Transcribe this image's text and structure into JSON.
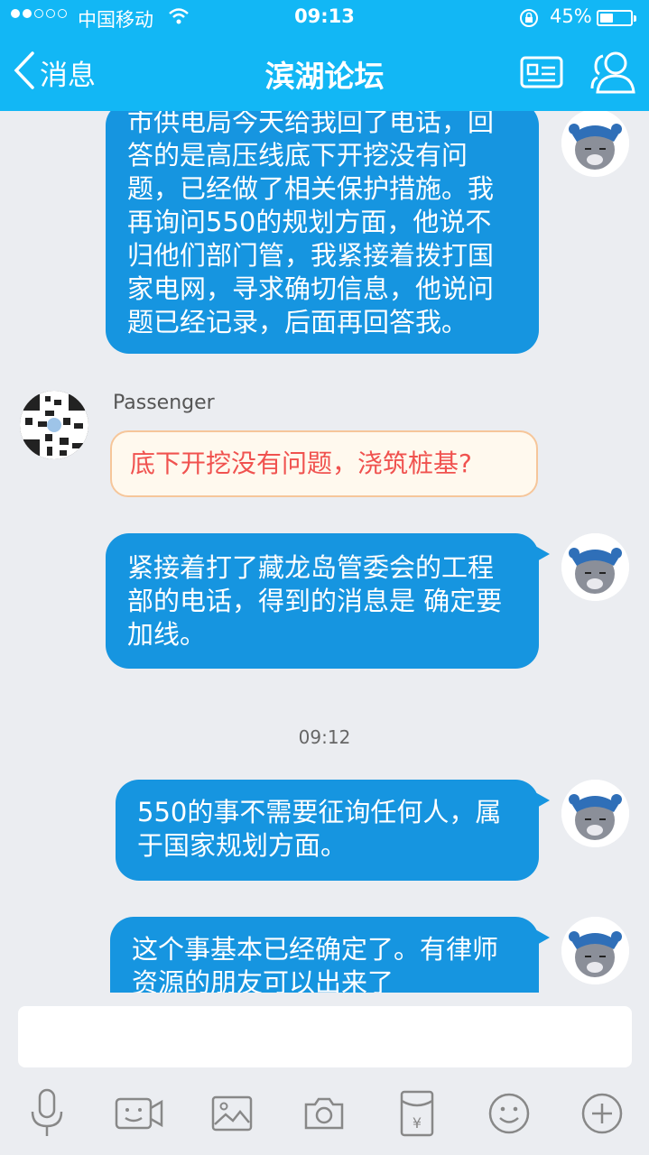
{
  "status": {
    "carrier": "中国移动",
    "time": "09:13",
    "battery": "45%",
    "battery_level": 0.45
  },
  "nav": {
    "back_label": "消息",
    "title": "滨湖论坛"
  },
  "messages": [
    {
      "text": "市供电局今天给我回了电话，回答的是高压线底下开挖没有问题，已经做了相关保护措施。我再询问550的规划方面，他说不归他们部门管，我紧接着拨打国家电网，寻求确切信息，他说问题已经记录，后面再回答我。"
    },
    {
      "sender": "Passenger",
      "text": "底下开挖没有问题，浇筑桩基?"
    },
    {
      "text": "紧接着打了藏龙岛管委会的工程部的电话，得到的消息是 确定要加线。"
    },
    {
      "timestamp": "09:12"
    },
    {
      "text": "550的事不需要征询任何人，属于国家规划方面。"
    },
    {
      "text": "这个事基本已经确定了。有律师资源的朋友可以出来了"
    }
  ],
  "input": {
    "placeholder": ""
  },
  "toolbar_icons": [
    "microphone-icon",
    "video-call-icon",
    "image-icon",
    "camera-icon",
    "red-packet-icon",
    "emoji-icon",
    "plus-icon"
  ]
}
